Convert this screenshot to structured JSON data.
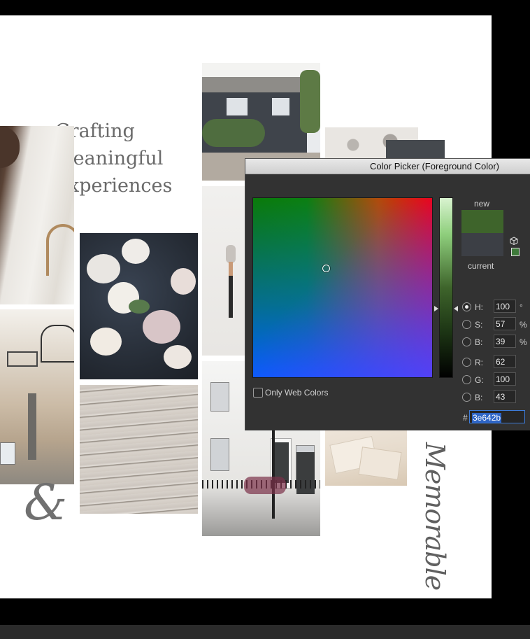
{
  "canvas": {
    "headline": [
      "Crafting",
      "meaningful",
      "experiences"
    ],
    "ampersand": "&",
    "script_word": "Memorable"
  },
  "picker": {
    "title": "Color Picker (Foreground Color)",
    "new_label": "new",
    "current_label": "current",
    "new_color": "#3e642b",
    "current_color": "#3c3f45",
    "only_web_colors_label": "Only Web Colors",
    "only_web_colors_checked": false,
    "selected_channel": "H",
    "fields": [
      {
        "key": "H",
        "label": "H:",
        "value": "100",
        "unit": "°"
      },
      {
        "key": "S",
        "label": "S:",
        "value": "57",
        "unit": "%"
      },
      {
        "key": "Bv",
        "label": "B:",
        "value": "39",
        "unit": "%"
      },
      {
        "key": "R",
        "label": "R:",
        "value": "62",
        "unit": ""
      },
      {
        "key": "G",
        "label": "G:",
        "value": "100",
        "unit": ""
      },
      {
        "key": "Bb",
        "label": "B:",
        "value": "43",
        "unit": ""
      }
    ],
    "hash_label": "#",
    "hex_value": "3e642b",
    "icons": [
      "cube-icon",
      "web-safe-swatch-icon",
      "out-of-gamut-icon"
    ]
  }
}
